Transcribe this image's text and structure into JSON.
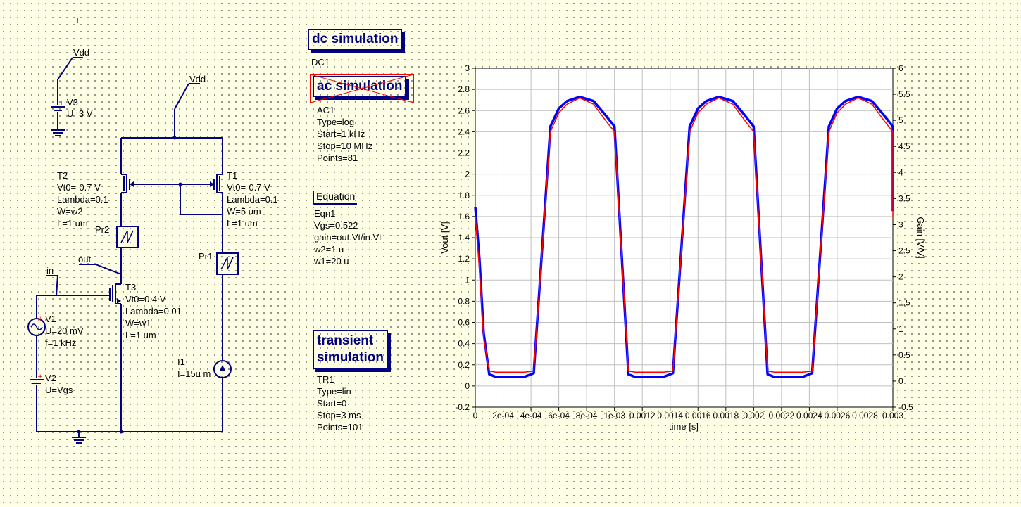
{
  "schematic": {
    "vdd_top": "Vdd",
    "v3": {
      "name": "V3",
      "u": "U=3 V"
    },
    "vdd_mid": "Vdd",
    "t2": [
      "T2",
      "Vt0=-0.7 V",
      "Lambda=0.1",
      "W=w2",
      "L=1 um"
    ],
    "t1": [
      "T1",
      "Vt0=-0.7 V",
      "Lambda=0.1",
      "W=5 um",
      "L=1 um"
    ],
    "pr2": "Pr2",
    "pr1": "Pr1",
    "out": "out",
    "in": "in",
    "t3": [
      "T3",
      "Vt0=0.4 V",
      "Lambda=0.01",
      "W=w1",
      "L=1 um"
    ],
    "v1": [
      "V1",
      "U=20 mV",
      "f=1 kHz"
    ],
    "v2": [
      "V2",
      "U=Vgs"
    ],
    "i1": [
      "I1",
      "I=15u m"
    ]
  },
  "simulations": {
    "dc": {
      "title": "dc simulation",
      "name": "DC1"
    },
    "ac": {
      "title": "ac simulation",
      "props": [
        "AC1",
        "Type=log",
        "Start=1 kHz",
        "Stop=10 MHz",
        "Points=81"
      ]
    },
    "equation": {
      "title": "Equation",
      "props": [
        "Eqn1",
        "Vgs=0.522",
        "gain=out.Vt/in.Vt",
        "w2=1 u",
        "w1=20 u"
      ]
    },
    "transient": {
      "title_line1": "transient",
      "title_line2": "simulation",
      "props": [
        "TR1",
        "Type=lin",
        "Start=0",
        "Stop=3 ms",
        "Points=101"
      ]
    }
  },
  "colors": {
    "wire": "#000080",
    "background": "#ffffe6",
    "series_blue": "#0000ff",
    "series_red": "#ff0000",
    "grid": "#bfbfbf"
  },
  "chart_data": {
    "type": "line",
    "xlabel": "time [s]",
    "ylabel": "Vout [V]",
    "y2label": "Gain [V/V]",
    "xlim": [
      0,
      0.003
    ],
    "ylim": [
      -0.2,
      3
    ],
    "y2lim": [
      -0.5,
      6
    ],
    "x_ticks": [
      "0",
      "2e-04",
      "4e-04",
      "6e-04",
      "8e-04",
      "1e-03",
      "0.0012",
      "0.0014",
      "0.0016",
      "0.0018",
      "0.002",
      "0.0022",
      "0.0024",
      "0.0026",
      "0.0028",
      "0.003"
    ],
    "y_ticks": [
      "-0.2",
      "0",
      "0.2",
      "0.4",
      "0.6",
      "0.8",
      "1",
      "1.2",
      "1.4",
      "1.6",
      "1.8",
      "2",
      "2.2",
      "2.4",
      "2.6",
      "2.8",
      "3"
    ],
    "y2_ticks": [
      "-0.5",
      "0",
      "0.5",
      "1",
      "1.5",
      "2",
      "2.5",
      "3",
      "3.5",
      "4",
      "4.5",
      "5",
      "5.5",
      "6"
    ],
    "grid": true,
    "series": [
      {
        "color": "#0000ff",
        "width": 3.5,
        "x": [
          0,
          3e-05,
          6e-05,
          0.0001,
          0.00015,
          0.00035,
          0.00042,
          0.00054,
          0.0006,
          0.00066,
          0.00075,
          0.00085,
          0.00094,
          0.001,
          0.00105,
          0.00112,
          0.00118,
          0.00125,
          0.00155,
          0.00162,
          0.00173,
          0.0018,
          0.00187,
          0.0019,
          0.002,
          0.00205,
          0.0021,
          0.00118,
          0.0013
        ],
        "y": [
          1.69,
          1.2,
          0.5,
          0.11,
          0.085,
          0.085,
          0.12,
          2.45,
          2.62,
          2.69,
          2.73,
          2.69,
          2.55,
          2.45,
          1.5,
          0.12,
          0.085,
          0.085,
          0.12,
          2.5,
          2.7,
          2.73,
          2.69,
          2.62,
          2.47,
          1.7,
          0.12,
          0.085,
          0.085
        ]
      },
      {
        "color": "#ff0000",
        "width": 1.5,
        "x": [
          0,
          3e-05,
          6e-05,
          0.0001,
          0.00015,
          0.00035,
          0.00042,
          0.00054,
          0.0006,
          0.00066,
          0.00075,
          0.00085,
          0.00094,
          0.001
        ],
        "y": [
          1.6,
          1.1,
          0.45,
          0.14,
          0.13,
          0.13,
          0.14,
          2.4,
          2.58,
          2.66,
          2.72,
          2.66,
          2.5,
          2.4
        ]
      }
    ]
  }
}
